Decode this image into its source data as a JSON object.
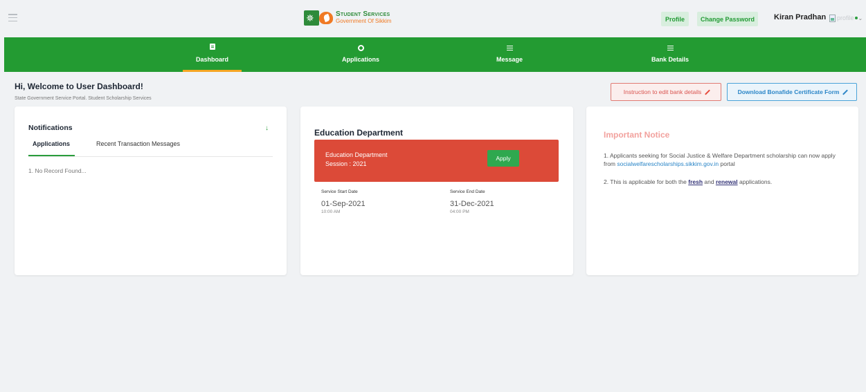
{
  "header": {
    "logo_title": "Student Services",
    "logo_subtitle": "Government Of Sikkim",
    "profile_label": "Profile",
    "change_password_label": "Change Password",
    "user_name": "Kiran Pradhan",
    "avatar_alt": "profile"
  },
  "nav": {
    "items": [
      {
        "label": "Dashboard",
        "icon": "document-icon"
      },
      {
        "label": "Applications",
        "icon": "gear-icon"
      },
      {
        "label": "Message",
        "icon": "menu-icon"
      },
      {
        "label": "Bank Details",
        "icon": "menu-icon"
      }
    ],
    "active_index": 0,
    "accent": "#239b32",
    "active_underline": "#f5a623"
  },
  "welcome": {
    "title": "Hi, Welcome to User Dashboard!",
    "subtitle": "State Government Service Portal. Student Scholarship Services",
    "instruction_button": "Instruction to edit bank details",
    "download_button": "Download Bonafide Certificate Form"
  },
  "notifications": {
    "title": "Notifications",
    "tabs": [
      "Applications",
      "Recent Transaction Messages"
    ],
    "empty_text": "1. No Record Found..."
  },
  "education": {
    "title": "Education Department",
    "box_line1": "Education Department",
    "box_line2": "Session : 2021",
    "apply_label": "Apply",
    "start_label": "Service Start Date",
    "start_date": "01-Sep-2021",
    "start_time": "10:00 AM",
    "end_label": "Service End Date",
    "end_date": "31-Dec-2021",
    "end_time": "04:00 PM",
    "box_color": "#dc4a38"
  },
  "notice": {
    "title": "Important Notice",
    "p1_text": "1. Applicants seeking for Social Justice & Welfare Department scholarship can now apply from",
    "p1_link": "socialwelfarescholarships.sikkim.gov.in",
    "p1_tail": "portal",
    "p2_pre": "2. This is applicable for both the",
    "p2_fresh": "fresh",
    "p2_and": "and",
    "p2_renewal": "renewal",
    "p2_tail": "applications."
  }
}
